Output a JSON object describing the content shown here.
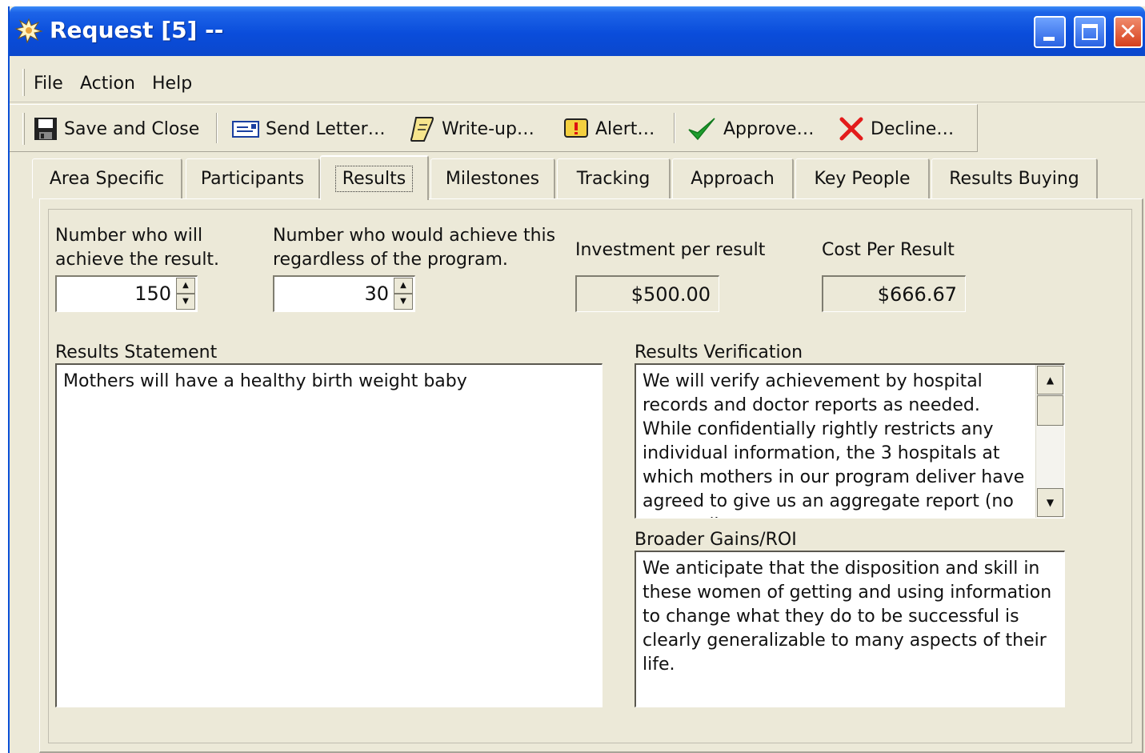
{
  "window": {
    "title": "Request [5] --",
    "accent_color": "#0a4ddb",
    "close_color": "#d6401c"
  },
  "menu": {
    "file": "File",
    "action": "Action",
    "help": "Help"
  },
  "toolbar": {
    "save_close": "Save and Close",
    "send_letter": "Send Letter…",
    "write_up": "Write-up…",
    "alert": "Alert…",
    "approve": "Approve…",
    "decline": "Decline…",
    "icons": [
      "floppy-disk-icon",
      "letter-icon",
      "scroll-icon",
      "alert-icon",
      "checkmark-icon",
      "red-x-icon"
    ]
  },
  "tabs": [
    {
      "label": "Area Specific"
    },
    {
      "label": "Participants"
    },
    {
      "label": "Results",
      "active": true
    },
    {
      "label": "Milestones"
    },
    {
      "label": "Tracking"
    },
    {
      "label": "Approach"
    },
    {
      "label": "Key People"
    },
    {
      "label": "Results Buying"
    }
  ],
  "fields": {
    "number_achieve_label": "Number who will achieve the result.",
    "number_achieve_value": "150",
    "regardless_label": "Number who would achieve this regardless of the program.",
    "regardless_value": "30",
    "investment_label": "Investment per result",
    "investment_value": "$500.00",
    "cost_label": "Cost Per Result",
    "cost_value": "$666.67"
  },
  "results_statement": {
    "label": "Results Statement",
    "text": "Mothers will have a healthy birth weight baby"
  },
  "results_verification": {
    "label": "Results Verification",
    "text": "We will verify achievement by hospital records and doctor reports as needed. While confidentially rightly restricts any individual information, the 3 hospitals at which mothers in our program deliver have agreed to give us an aggregate report (no names (just"
  },
  "broader_gains": {
    "label": "Broader Gains/ROI",
    "text": "We anticipate that the disposition and skill in these women of getting and using information to change what they do to be successful is clearly generalizable to many aspects of their life."
  }
}
